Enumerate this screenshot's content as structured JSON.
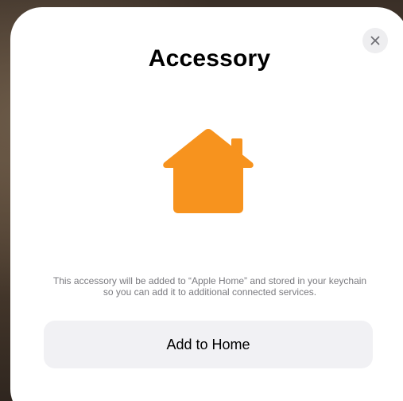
{
  "dialog": {
    "title": "Accessory",
    "description": "This accessory will be added to “Apple Home” and stored in your keychain so you can add it to additional connected services.",
    "close_icon": "close-icon",
    "accessory_icon": "house-icon",
    "primary_button_label": "Add to Home"
  },
  "colors": {
    "accent_house": "#f7931e",
    "button_bg": "#f1f1f4",
    "close_bg": "#eeeef0"
  }
}
